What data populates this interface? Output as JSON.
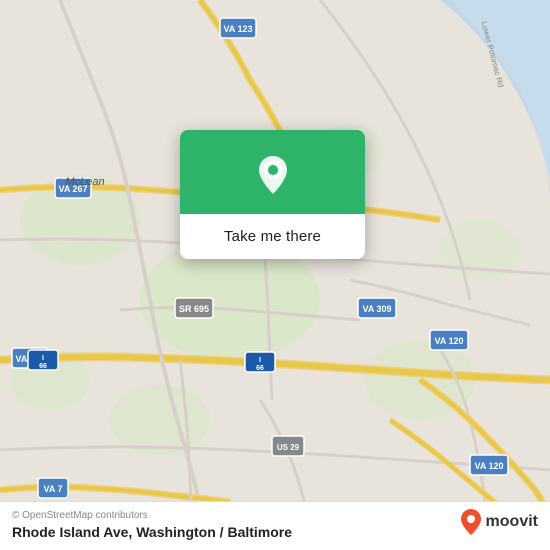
{
  "map": {
    "background_color": "#e8e4dc",
    "center_lat": 38.92,
    "center_lng": -77.12
  },
  "popup": {
    "button_label": "Take me there",
    "pin_icon": "location-pin"
  },
  "bottom_bar": {
    "copyright": "© OpenStreetMap contributors",
    "location_title": "Rhode Island Ave, Washington / Baltimore"
  },
  "moovit": {
    "text": "moovit"
  },
  "road_labels": {
    "va123": "VA 123",
    "va267_top": "VA 267",
    "va267_bottom": "VA 267",
    "sr695": "SR 695",
    "va309": "VA 309",
    "i66_left": "I 66",
    "i66_right": "I 66",
    "va7": "VA 7",
    "us29": "US 29",
    "va120_top": "VA 120",
    "va120_bottom": "VA 120",
    "mclean": "McLean",
    "lower_potomac": "Lower Potomac Rd"
  }
}
